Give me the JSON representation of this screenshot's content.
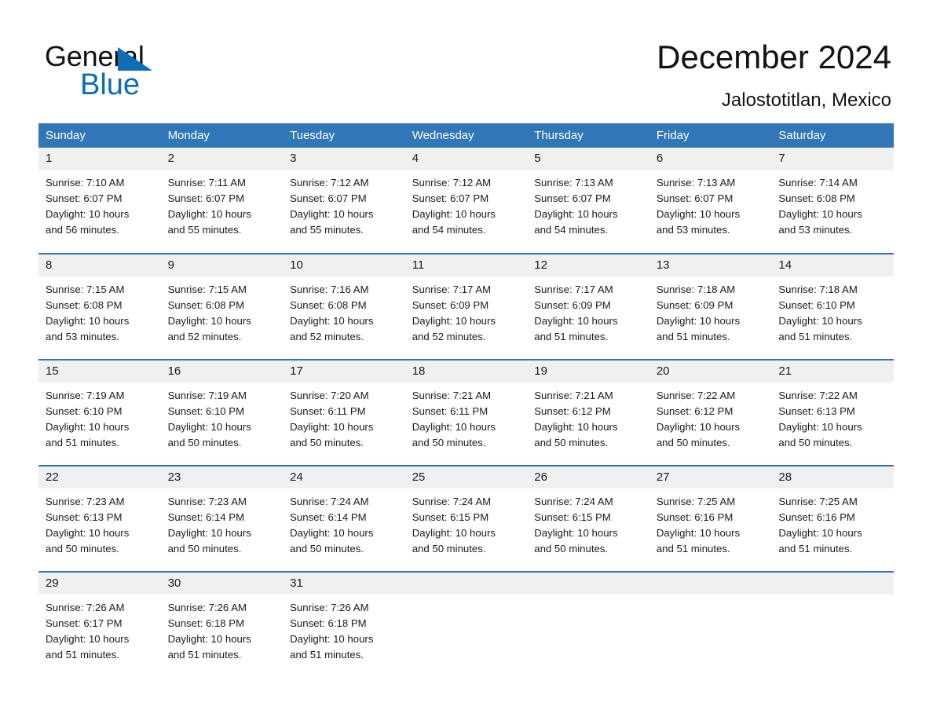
{
  "brand": {
    "name_part1": "General",
    "name_part2": "Blue",
    "triangle_icon": "blue-triangle-icon",
    "accent_color": "#0f6cb6"
  },
  "header": {
    "title": "December 2024",
    "subtitle": "Jalostotitlan, Mexico",
    "header_bg_color": "#3176b7",
    "daynum_bg_color": "#f0f0f0"
  },
  "weekdays": [
    "Sunday",
    "Monday",
    "Tuesday",
    "Wednesday",
    "Thursday",
    "Friday",
    "Saturday"
  ],
  "weeks": [
    [
      {
        "day": "1",
        "sunrise": "Sunrise: 7:10 AM",
        "sunset": "Sunset: 6:07 PM",
        "daylight_l1": "Daylight: 10 hours",
        "daylight_l2": "and 56 minutes."
      },
      {
        "day": "2",
        "sunrise": "Sunrise: 7:11 AM",
        "sunset": "Sunset: 6:07 PM",
        "daylight_l1": "Daylight: 10 hours",
        "daylight_l2": "and 55 minutes."
      },
      {
        "day": "3",
        "sunrise": "Sunrise: 7:12 AM",
        "sunset": "Sunset: 6:07 PM",
        "daylight_l1": "Daylight: 10 hours",
        "daylight_l2": "and 55 minutes."
      },
      {
        "day": "4",
        "sunrise": "Sunrise: 7:12 AM",
        "sunset": "Sunset: 6:07 PM",
        "daylight_l1": "Daylight: 10 hours",
        "daylight_l2": "and 54 minutes."
      },
      {
        "day": "5",
        "sunrise": "Sunrise: 7:13 AM",
        "sunset": "Sunset: 6:07 PM",
        "daylight_l1": "Daylight: 10 hours",
        "daylight_l2": "and 54 minutes."
      },
      {
        "day": "6",
        "sunrise": "Sunrise: 7:13 AM",
        "sunset": "Sunset: 6:07 PM",
        "daylight_l1": "Daylight: 10 hours",
        "daylight_l2": "and 53 minutes."
      },
      {
        "day": "7",
        "sunrise": "Sunrise: 7:14 AM",
        "sunset": "Sunset: 6:08 PM",
        "daylight_l1": "Daylight: 10 hours",
        "daylight_l2": "and 53 minutes."
      }
    ],
    [
      {
        "day": "8",
        "sunrise": "Sunrise: 7:15 AM",
        "sunset": "Sunset: 6:08 PM",
        "daylight_l1": "Daylight: 10 hours",
        "daylight_l2": "and 53 minutes."
      },
      {
        "day": "9",
        "sunrise": "Sunrise: 7:15 AM",
        "sunset": "Sunset: 6:08 PM",
        "daylight_l1": "Daylight: 10 hours",
        "daylight_l2": "and 52 minutes."
      },
      {
        "day": "10",
        "sunrise": "Sunrise: 7:16 AM",
        "sunset": "Sunset: 6:08 PM",
        "daylight_l1": "Daylight: 10 hours",
        "daylight_l2": "and 52 minutes."
      },
      {
        "day": "11",
        "sunrise": "Sunrise: 7:17 AM",
        "sunset": "Sunset: 6:09 PM",
        "daylight_l1": "Daylight: 10 hours",
        "daylight_l2": "and 52 minutes."
      },
      {
        "day": "12",
        "sunrise": "Sunrise: 7:17 AM",
        "sunset": "Sunset: 6:09 PM",
        "daylight_l1": "Daylight: 10 hours",
        "daylight_l2": "and 51 minutes."
      },
      {
        "day": "13",
        "sunrise": "Sunrise: 7:18 AM",
        "sunset": "Sunset: 6:09 PM",
        "daylight_l1": "Daylight: 10 hours",
        "daylight_l2": "and 51 minutes."
      },
      {
        "day": "14",
        "sunrise": "Sunrise: 7:18 AM",
        "sunset": "Sunset: 6:10 PM",
        "daylight_l1": "Daylight: 10 hours",
        "daylight_l2": "and 51 minutes."
      }
    ],
    [
      {
        "day": "15",
        "sunrise": "Sunrise: 7:19 AM",
        "sunset": "Sunset: 6:10 PM",
        "daylight_l1": "Daylight: 10 hours",
        "daylight_l2": "and 51 minutes."
      },
      {
        "day": "16",
        "sunrise": "Sunrise: 7:19 AM",
        "sunset": "Sunset: 6:10 PM",
        "daylight_l1": "Daylight: 10 hours",
        "daylight_l2": "and 50 minutes."
      },
      {
        "day": "17",
        "sunrise": "Sunrise: 7:20 AM",
        "sunset": "Sunset: 6:11 PM",
        "daylight_l1": "Daylight: 10 hours",
        "daylight_l2": "and 50 minutes."
      },
      {
        "day": "18",
        "sunrise": "Sunrise: 7:21 AM",
        "sunset": "Sunset: 6:11 PM",
        "daylight_l1": "Daylight: 10 hours",
        "daylight_l2": "and 50 minutes."
      },
      {
        "day": "19",
        "sunrise": "Sunrise: 7:21 AM",
        "sunset": "Sunset: 6:12 PM",
        "daylight_l1": "Daylight: 10 hours",
        "daylight_l2": "and 50 minutes."
      },
      {
        "day": "20",
        "sunrise": "Sunrise: 7:22 AM",
        "sunset": "Sunset: 6:12 PM",
        "daylight_l1": "Daylight: 10 hours",
        "daylight_l2": "and 50 minutes."
      },
      {
        "day": "21",
        "sunrise": "Sunrise: 7:22 AM",
        "sunset": "Sunset: 6:13 PM",
        "daylight_l1": "Daylight: 10 hours",
        "daylight_l2": "and 50 minutes."
      }
    ],
    [
      {
        "day": "22",
        "sunrise": "Sunrise: 7:23 AM",
        "sunset": "Sunset: 6:13 PM",
        "daylight_l1": "Daylight: 10 hours",
        "daylight_l2": "and 50 minutes."
      },
      {
        "day": "23",
        "sunrise": "Sunrise: 7:23 AM",
        "sunset": "Sunset: 6:14 PM",
        "daylight_l1": "Daylight: 10 hours",
        "daylight_l2": "and 50 minutes."
      },
      {
        "day": "24",
        "sunrise": "Sunrise: 7:24 AM",
        "sunset": "Sunset: 6:14 PM",
        "daylight_l1": "Daylight: 10 hours",
        "daylight_l2": "and 50 minutes."
      },
      {
        "day": "25",
        "sunrise": "Sunrise: 7:24 AM",
        "sunset": "Sunset: 6:15 PM",
        "daylight_l1": "Daylight: 10 hours",
        "daylight_l2": "and 50 minutes."
      },
      {
        "day": "26",
        "sunrise": "Sunrise: 7:24 AM",
        "sunset": "Sunset: 6:15 PM",
        "daylight_l1": "Daylight: 10 hours",
        "daylight_l2": "and 50 minutes."
      },
      {
        "day": "27",
        "sunrise": "Sunrise: 7:25 AM",
        "sunset": "Sunset: 6:16 PM",
        "daylight_l1": "Daylight: 10 hours",
        "daylight_l2": "and 51 minutes."
      },
      {
        "day": "28",
        "sunrise": "Sunrise: 7:25 AM",
        "sunset": "Sunset: 6:16 PM",
        "daylight_l1": "Daylight: 10 hours",
        "daylight_l2": "and 51 minutes."
      }
    ],
    [
      {
        "day": "29",
        "sunrise": "Sunrise: 7:26 AM",
        "sunset": "Sunset: 6:17 PM",
        "daylight_l1": "Daylight: 10 hours",
        "daylight_l2": "and 51 minutes."
      },
      {
        "day": "30",
        "sunrise": "Sunrise: 7:26 AM",
        "sunset": "Sunset: 6:18 PM",
        "daylight_l1": "Daylight: 10 hours",
        "daylight_l2": "and 51 minutes."
      },
      {
        "day": "31",
        "sunrise": "Sunrise: 7:26 AM",
        "sunset": "Sunset: 6:18 PM",
        "daylight_l1": "Daylight: 10 hours",
        "daylight_l2": "and 51 minutes."
      },
      {
        "day": "",
        "sunrise": "",
        "sunset": "",
        "daylight_l1": "",
        "daylight_l2": "",
        "blank": true
      },
      {
        "day": "",
        "sunrise": "",
        "sunset": "",
        "daylight_l1": "",
        "daylight_l2": "",
        "blank": true
      },
      {
        "day": "",
        "sunrise": "",
        "sunset": "",
        "daylight_l1": "",
        "daylight_l2": "",
        "blank": true
      },
      {
        "day": "",
        "sunrise": "",
        "sunset": "",
        "daylight_l1": "",
        "daylight_l2": "",
        "blank": true
      }
    ]
  ]
}
